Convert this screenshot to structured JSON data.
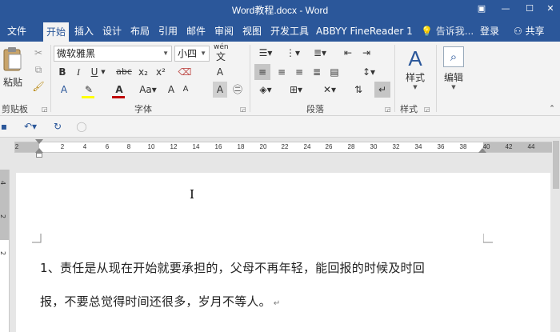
{
  "window": {
    "title": "Word教程.docx - Word"
  },
  "tabs": [
    {
      "label": "文件",
      "active": false
    },
    {
      "label": "开始",
      "active": true
    },
    {
      "label": "插入",
      "active": false
    },
    {
      "label": "设计",
      "active": false
    },
    {
      "label": "布局",
      "active": false
    },
    {
      "label": "引用",
      "active": false
    },
    {
      "label": "邮件",
      "active": false
    },
    {
      "label": "审阅",
      "active": false
    },
    {
      "label": "视图",
      "active": false
    },
    {
      "label": "开发工具",
      "active": false
    },
    {
      "label": "ABBYY FineReader 1",
      "active": false
    }
  ],
  "tellme": {
    "placeholder": "告诉我..."
  },
  "account": {
    "signin": "登录",
    "share": "共享"
  },
  "ribbon": {
    "clipboard": {
      "paste_label": "粘贴",
      "group_label": "剪贴板"
    },
    "font": {
      "font_name": "微软雅黑",
      "font_size": "小四",
      "group_label": "字体",
      "wen_label": "wén",
      "wen_char": "文"
    },
    "paragraph": {
      "group_label": "段落"
    },
    "styles": {
      "button_label": "样式",
      "group_label": "样式"
    },
    "editing": {
      "button_label": "编辑"
    }
  },
  "ruler": {
    "ticks": [
      "2",
      "2",
      "4",
      "6",
      "8",
      "10",
      "12",
      "14",
      "16",
      "18",
      "20",
      "22",
      "24",
      "26",
      "28",
      "30",
      "32",
      "34",
      "36",
      "38",
      "40",
      "42",
      "44"
    ]
  },
  "vruler": {
    "ticks": [
      "4",
      "2",
      "2"
    ]
  },
  "document": {
    "line1": "1、责任是从现在开始就要承担的，父母不再年轻，能回报的时候及时回",
    "line2": "报，不要总觉得时间还很多，岁月不等人。",
    "para_mark": "↵"
  },
  "colors": {
    "accent": "#2b579a",
    "highlight": "#ffff00",
    "font_color": "#c00000"
  }
}
